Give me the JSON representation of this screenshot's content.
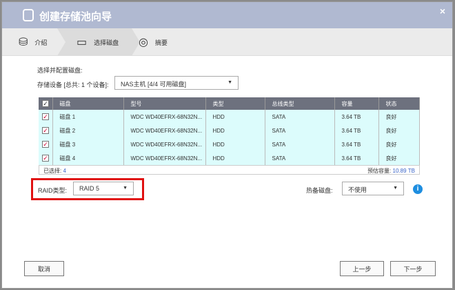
{
  "title": "创建存储池向导",
  "steps": [
    "介绍",
    "选择磁盘",
    "摘要"
  ],
  "section_label": "选择并配置磁盘:",
  "device_label": "存储设备 [总共: 1 个设备]:",
  "device_value": "NAS主机 [4/4 可用磁盘]",
  "table": {
    "headers": [
      "磁盘",
      "型号",
      "类型",
      "总线类型",
      "容量",
      "状态"
    ],
    "rows": [
      [
        "磁盘 1",
        "WDC WD40EFRX-68N32N...",
        "HDD",
        "SATA",
        "3.64 TB",
        "良好"
      ],
      [
        "磁盘 2",
        "WDC WD40EFRX-68N32N...",
        "HDD",
        "SATA",
        "3.64 TB",
        "良好"
      ],
      [
        "磁盘 3",
        "WDC WD40EFRX-68N32N...",
        "HDD",
        "SATA",
        "3.64 TB",
        "良好"
      ],
      [
        "磁盘 4",
        "WDC WD40EFRX-68N32N...",
        "HDD",
        "SATA",
        "3.64 TB",
        "良好"
      ]
    ]
  },
  "selected_label": "已选择:",
  "selected_count": "4",
  "est_label": "预估容量:",
  "est_value": "10.89 TB",
  "raid_label": "RAID类型:",
  "raid_value": "RAID 5",
  "spare_label": "热备磁盘:",
  "spare_value": "不使用",
  "buttons": {
    "cancel": "取消",
    "prev": "上一步",
    "next": "下一步"
  },
  "icons": {
    "close": "×",
    "check": "✓",
    "arrow": "▼",
    "info": "i"
  }
}
